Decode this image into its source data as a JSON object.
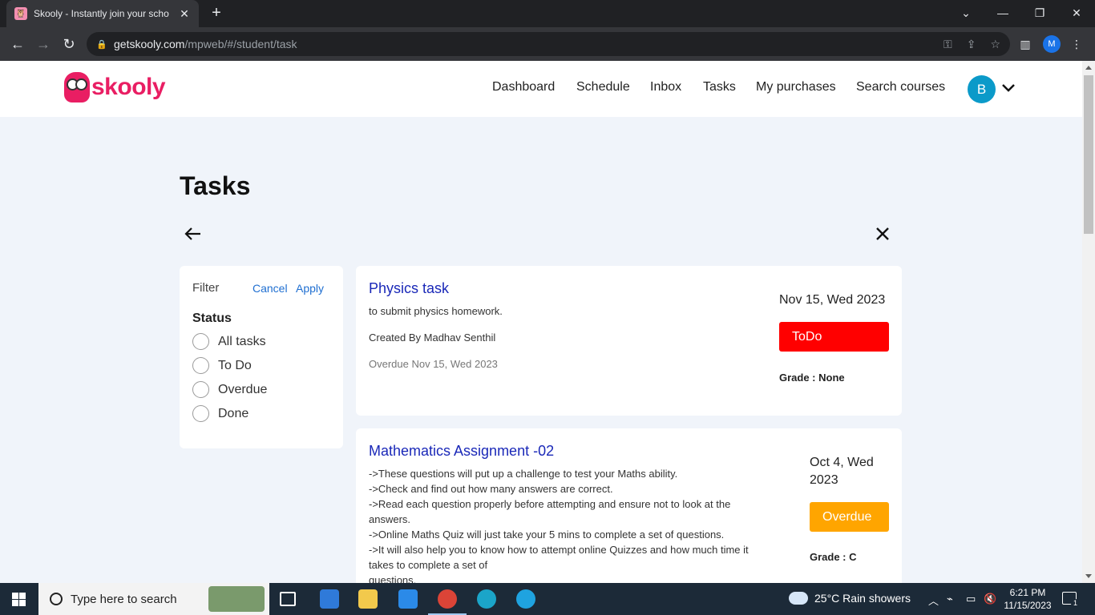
{
  "browser": {
    "tab_title": "Skooly - Instantly join your scho",
    "tab_close": "✕",
    "new_tab": "+",
    "url_domain": "getskooly.com",
    "url_path": "/mpweb/#/student/task",
    "profile_initial": "M"
  },
  "site": {
    "logo_text": "skooly",
    "nav": [
      "Dashboard",
      "Schedule",
      "Inbox",
      "Tasks",
      "My purchases",
      "Search courses"
    ],
    "avatar_initial": "B"
  },
  "page": {
    "title": "Tasks"
  },
  "filter": {
    "label": "Filter",
    "cancel": "Cancel",
    "apply": "Apply",
    "status_heading": "Status",
    "options": [
      "All tasks",
      "To Do",
      "Overdue",
      "Done"
    ]
  },
  "tasks": [
    {
      "title": "Physics task",
      "description": "to submit physics homework.",
      "created_by": "Created By Madhav Senthil",
      "overdue": "Overdue Nov 15, Wed 2023",
      "date": "Nov 15, Wed 2023",
      "status": "ToDo",
      "status_color": "#ff0000",
      "grade": "Grade : None"
    },
    {
      "title": "Mathematics Assignment -02",
      "description_lines": [
        "->These questions will put up a challenge to test your Maths ability.",
        "->Check and find out how many answers are correct.",
        "->Read each question properly before attempting and ensure not to look at the",
        "answers.",
        "->Online Maths Quiz will just take your 5 mins to complete a set of questions.",
        "->It will also help you to know how to attempt online Quizzes and how much time it",
        "takes to complete a set of",
        "questions."
      ],
      "date_line1": "Oct 4, Wed",
      "date_line2": "2023",
      "status": "Overdue",
      "status_color": "#ffa500",
      "grade": "Grade : C"
    }
  ],
  "taskbar": {
    "search_placeholder": "Type here to search",
    "weather": "25°C  Rain showers",
    "time": "6:21 PM",
    "date": "11/15/2023",
    "notification_count": "1"
  }
}
